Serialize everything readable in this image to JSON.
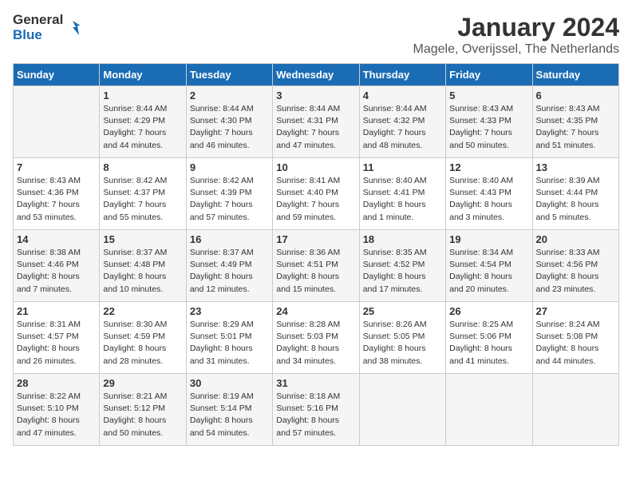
{
  "header": {
    "logo_general": "General",
    "logo_blue": "Blue",
    "month": "January 2024",
    "location": "Magele, Overijssel, The Netherlands"
  },
  "days_of_week": [
    "Sunday",
    "Monday",
    "Tuesday",
    "Wednesday",
    "Thursday",
    "Friday",
    "Saturday"
  ],
  "weeks": [
    [
      {
        "day": "",
        "info": ""
      },
      {
        "day": "1",
        "info": "Sunrise: 8:44 AM\nSunset: 4:29 PM\nDaylight: 7 hours\nand 44 minutes."
      },
      {
        "day": "2",
        "info": "Sunrise: 8:44 AM\nSunset: 4:30 PM\nDaylight: 7 hours\nand 46 minutes."
      },
      {
        "day": "3",
        "info": "Sunrise: 8:44 AM\nSunset: 4:31 PM\nDaylight: 7 hours\nand 47 minutes."
      },
      {
        "day": "4",
        "info": "Sunrise: 8:44 AM\nSunset: 4:32 PM\nDaylight: 7 hours\nand 48 minutes."
      },
      {
        "day": "5",
        "info": "Sunrise: 8:43 AM\nSunset: 4:33 PM\nDaylight: 7 hours\nand 50 minutes."
      },
      {
        "day": "6",
        "info": "Sunrise: 8:43 AM\nSunset: 4:35 PM\nDaylight: 7 hours\nand 51 minutes."
      }
    ],
    [
      {
        "day": "7",
        "info": "Sunrise: 8:43 AM\nSunset: 4:36 PM\nDaylight: 7 hours\nand 53 minutes."
      },
      {
        "day": "8",
        "info": "Sunrise: 8:42 AM\nSunset: 4:37 PM\nDaylight: 7 hours\nand 55 minutes."
      },
      {
        "day": "9",
        "info": "Sunrise: 8:42 AM\nSunset: 4:39 PM\nDaylight: 7 hours\nand 57 minutes."
      },
      {
        "day": "10",
        "info": "Sunrise: 8:41 AM\nSunset: 4:40 PM\nDaylight: 7 hours\nand 59 minutes."
      },
      {
        "day": "11",
        "info": "Sunrise: 8:40 AM\nSunset: 4:41 PM\nDaylight: 8 hours\nand 1 minute."
      },
      {
        "day": "12",
        "info": "Sunrise: 8:40 AM\nSunset: 4:43 PM\nDaylight: 8 hours\nand 3 minutes."
      },
      {
        "day": "13",
        "info": "Sunrise: 8:39 AM\nSunset: 4:44 PM\nDaylight: 8 hours\nand 5 minutes."
      }
    ],
    [
      {
        "day": "14",
        "info": "Sunrise: 8:38 AM\nSunset: 4:46 PM\nDaylight: 8 hours\nand 7 minutes."
      },
      {
        "day": "15",
        "info": "Sunrise: 8:37 AM\nSunset: 4:48 PM\nDaylight: 8 hours\nand 10 minutes."
      },
      {
        "day": "16",
        "info": "Sunrise: 8:37 AM\nSunset: 4:49 PM\nDaylight: 8 hours\nand 12 minutes."
      },
      {
        "day": "17",
        "info": "Sunrise: 8:36 AM\nSunset: 4:51 PM\nDaylight: 8 hours\nand 15 minutes."
      },
      {
        "day": "18",
        "info": "Sunrise: 8:35 AM\nSunset: 4:52 PM\nDaylight: 8 hours\nand 17 minutes."
      },
      {
        "day": "19",
        "info": "Sunrise: 8:34 AM\nSunset: 4:54 PM\nDaylight: 8 hours\nand 20 minutes."
      },
      {
        "day": "20",
        "info": "Sunrise: 8:33 AM\nSunset: 4:56 PM\nDaylight: 8 hours\nand 23 minutes."
      }
    ],
    [
      {
        "day": "21",
        "info": "Sunrise: 8:31 AM\nSunset: 4:57 PM\nDaylight: 8 hours\nand 26 minutes."
      },
      {
        "day": "22",
        "info": "Sunrise: 8:30 AM\nSunset: 4:59 PM\nDaylight: 8 hours\nand 28 minutes."
      },
      {
        "day": "23",
        "info": "Sunrise: 8:29 AM\nSunset: 5:01 PM\nDaylight: 8 hours\nand 31 minutes."
      },
      {
        "day": "24",
        "info": "Sunrise: 8:28 AM\nSunset: 5:03 PM\nDaylight: 8 hours\nand 34 minutes."
      },
      {
        "day": "25",
        "info": "Sunrise: 8:26 AM\nSunset: 5:05 PM\nDaylight: 8 hours\nand 38 minutes."
      },
      {
        "day": "26",
        "info": "Sunrise: 8:25 AM\nSunset: 5:06 PM\nDaylight: 8 hours\nand 41 minutes."
      },
      {
        "day": "27",
        "info": "Sunrise: 8:24 AM\nSunset: 5:08 PM\nDaylight: 8 hours\nand 44 minutes."
      }
    ],
    [
      {
        "day": "28",
        "info": "Sunrise: 8:22 AM\nSunset: 5:10 PM\nDaylight: 8 hours\nand 47 minutes."
      },
      {
        "day": "29",
        "info": "Sunrise: 8:21 AM\nSunset: 5:12 PM\nDaylight: 8 hours\nand 50 minutes."
      },
      {
        "day": "30",
        "info": "Sunrise: 8:19 AM\nSunset: 5:14 PM\nDaylight: 8 hours\nand 54 minutes."
      },
      {
        "day": "31",
        "info": "Sunrise: 8:18 AM\nSunset: 5:16 PM\nDaylight: 8 hours\nand 57 minutes."
      },
      {
        "day": "",
        "info": ""
      },
      {
        "day": "",
        "info": ""
      },
      {
        "day": "",
        "info": ""
      }
    ]
  ]
}
